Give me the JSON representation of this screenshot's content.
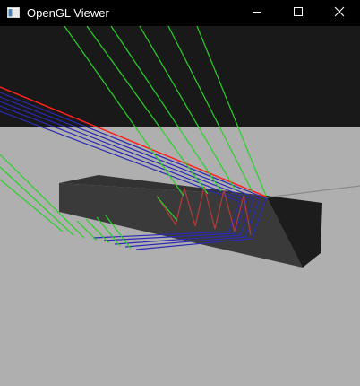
{
  "window": {
    "title": "OpenGL Viewer",
    "icon": "application-window-icon",
    "controls": [
      "minimize-icon",
      "maximize-icon",
      "close-icon"
    ]
  },
  "scene": {
    "colors": {
      "background_top": "#191919",
      "floor": "#afafaf",
      "box_front": "#3a3a3a",
      "box_top": "#333333",
      "box_end": "#1c1c1c",
      "incident_ray": "#ff2020",
      "secondary_rays": "#2a2ab4",
      "green_rays": "#29d229",
      "internal_path": "#b43a3a",
      "outgoing_ray": "#8a8a8a"
    }
  }
}
